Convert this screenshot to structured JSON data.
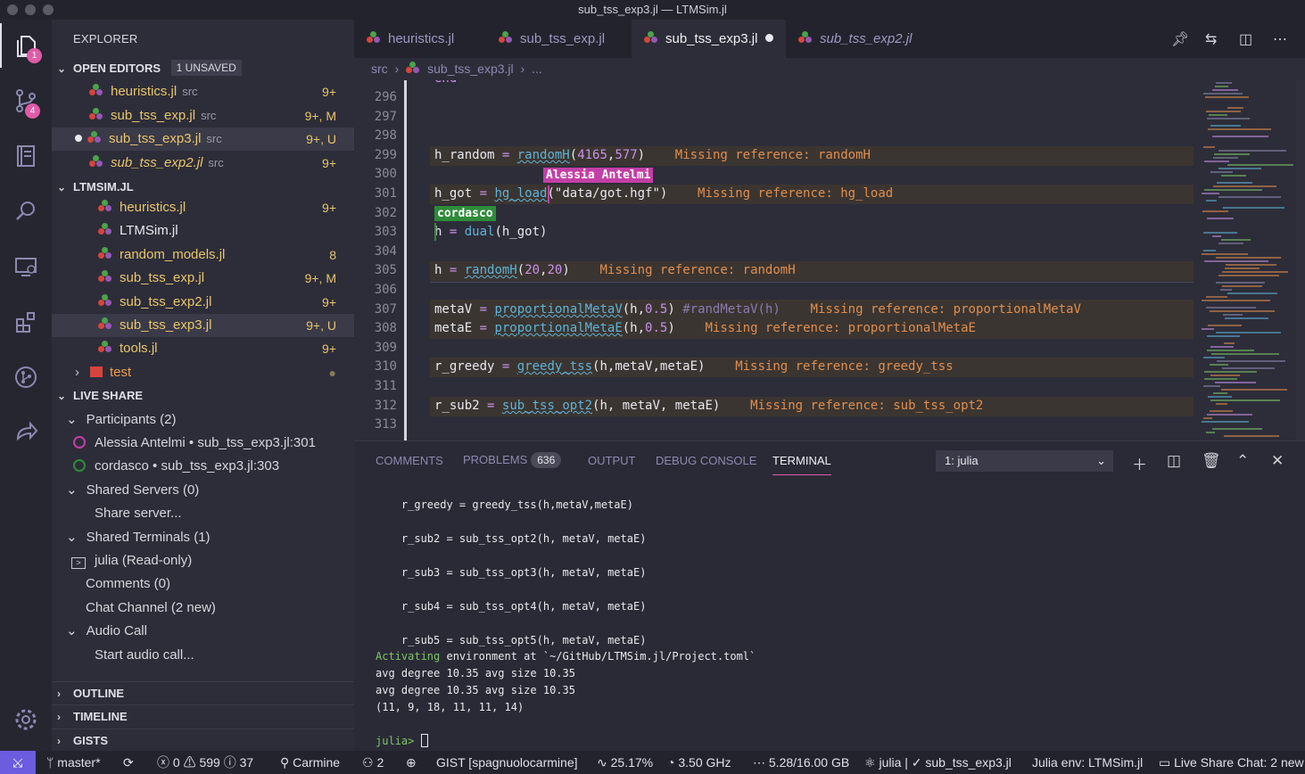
{
  "window": {
    "title": "sub_tss_exp3.jl — LTMSim.jl"
  },
  "activity": {
    "explorer_badge": "1",
    "scm_badge": "4"
  },
  "sidebar": {
    "title": "EXPLORER",
    "open_editors": {
      "label": "OPEN EDITORS",
      "unsaved": "1 UNSAVED",
      "items": [
        {
          "name": "heuristics.jl",
          "dir": "src",
          "dec": "9+"
        },
        {
          "name": "sub_tss_exp.jl",
          "dir": "src",
          "dec": "9+, M"
        },
        {
          "name": "sub_tss_exp3.jl",
          "dir": "src",
          "dec": "9+, U"
        },
        {
          "name": "sub_tss_exp2.jl",
          "dir": "src",
          "dec": "9+"
        }
      ]
    },
    "project": {
      "label": "LTMSIM.JL",
      "items": [
        {
          "name": "heuristics.jl",
          "dec": "9+"
        },
        {
          "name": "LTMSim.jl",
          "dec": ""
        },
        {
          "name": "random_models.jl",
          "dec": "8"
        },
        {
          "name": "sub_tss_exp.jl",
          "dec": "9+, M"
        },
        {
          "name": "sub_tss_exp2.jl",
          "dec": "9+"
        },
        {
          "name": "sub_tss_exp3.jl",
          "dec": "9+, U"
        },
        {
          "name": "tools.jl",
          "dec": "9+"
        },
        {
          "name": "test",
          "dec": "●"
        }
      ]
    },
    "live_share": {
      "label": "LIVE SHARE",
      "participants": "Participants (2)",
      "p1_name": "Alessia Antelmi",
      "p1_loc": "sub_tss_exp3.jl:301",
      "p2_name": "cordasco",
      "p2_loc": "sub_tss_exp3.jl:303",
      "bullet": "•",
      "shared_servers": "Shared Servers (0)",
      "share_server": "Share server...",
      "shared_terminals": "Shared Terminals (1)",
      "terminal": "julia (Read-only)",
      "comments": "Comments (0)",
      "chat": "Chat Channel (2 new)",
      "audio": "Audio Call",
      "start_audio": "Start audio call..."
    },
    "outline": "OUTLINE",
    "timeline": "TIMELINE",
    "gists": "GISTS"
  },
  "tabs": [
    {
      "label": "heuristics.jl"
    },
    {
      "label": "sub_tss_exp.jl"
    },
    {
      "label": "sub_tss_exp3.jl"
    },
    {
      "label": "sub_tss_exp2.jl"
    }
  ],
  "breadcrumb": {
    "folder": "src",
    "file": "sub_tss_exp3.jl",
    "rest": "..."
  },
  "editor": {
    "partial_top": "end",
    "line_numbers": [
      "296",
      "297",
      "298",
      "299",
      "300",
      "301",
      "302",
      "303",
      "304",
      "305",
      "306",
      "307",
      "308",
      "309",
      "310",
      "311",
      "312",
      "313"
    ],
    "l299_a": "h_random ",
    "l299_op": "=",
    "l299_fn": "randomH",
    "l299_b": "(",
    "l299_n1": "4165",
    "l299_c": ",",
    "l299_n2": "577",
    "l299_d": ")",
    "l299_err": "Missing reference: randomH",
    "l301_a": "h_got ",
    "l301_op": "=",
    "l301_fn": "hg_load",
    "l301_b": "(\"data/got.hgf\")",
    "l301_err": "Missing reference: hg_load",
    "l303_a": "h ",
    "l303_op": "=",
    "l303_fn": "dual",
    "l303_b": "(h_got)",
    "l305_a": "h ",
    "l305_op": "=",
    "l305_fn": "randomH",
    "l305_b": "(",
    "l305_n1": "20",
    "l305_c": ",",
    "l305_n2": "20",
    "l305_d": ")",
    "l305_err": "Missing reference: randomH",
    "l307_a": "metaV ",
    "l307_op": "=",
    "l307_fn": "proportionalMetaV",
    "l307_b": "(h,",
    "l307_n": "0.5",
    "l307_c": ")",
    "l307_cmt": "#randMetaV(h)",
    "l307_err": "Missing reference: proportionalMetaV",
    "l308_a": "metaE ",
    "l308_op": "=",
    "l308_fn": "proportionalMetaE",
    "l308_b": "(h,",
    "l308_n": "0.5",
    "l308_c": ")",
    "l308_err": "Missing reference: proportionalMetaE",
    "l310_a": "r_greedy ",
    "l310_op": "=",
    "l310_fn": "greedy_tss",
    "l310_b": "(h,metaV,metaE)",
    "l310_err": "Missing reference: greedy_tss",
    "l312_a": "r_sub2 ",
    "l312_op": "=",
    "l312_fn": "sub_tss_opt2",
    "l312_b": "(h, metaV, metaE)",
    "l312_err": "Missing reference: sub_tss_opt2",
    "flag1": "Alessia Antelmi",
    "flag2": "cordasco",
    "flag1_color": "#c23fa6",
    "flag2_color": "#2e8b3a"
  },
  "panel": {
    "tabs": [
      "COMMENTS",
      "PROBLEMS",
      "OUTPUT",
      "DEBUG CONSOLE",
      "TERMINAL"
    ],
    "problems_count": "636",
    "terminal_select": "1: julia",
    "terminal": {
      "l1": "    r_greedy = greedy_tss(h,metaV,metaE)",
      "l2": "    r_sub2 = sub_tss_opt2(h, metaV, metaE)",
      "l3": "    r_sub3 = sub_tss_opt3(h, metaV, metaE)",
      "l4": "    r_sub4 = sub_tss_opt4(h, metaV, metaE)",
      "l5": "    r_sub5 = sub_tss_opt5(h, metaV, metaE)",
      "l6a": "Activating",
      "l6b": " environment at `~/GitHub/LTMSim.jl/Project.toml`",
      "l7": "avg degree 10.35 avg size 10.35",
      "l8": "avg degree 10.35 avg size 10.35",
      "l9": "(11, 9, 18, 11, 11, 14)",
      "prompt": "julia> "
    }
  },
  "status": {
    "branch": "master*",
    "errors": "0",
    "warnings": "599",
    "infos": "37",
    "user": "Carmine",
    "users_count": "2",
    "gist": "GIST [spagnuolocarmine]",
    "cpu": "25.17%",
    "freq": "3.50 GHz",
    "mem": "5.28/16.00 GB",
    "julia": "julia | ✓ sub_tss_exp3.jl",
    "julia_env": "Julia env: LTMSim.jl",
    "chat": "Live Share Chat: 2 new"
  }
}
